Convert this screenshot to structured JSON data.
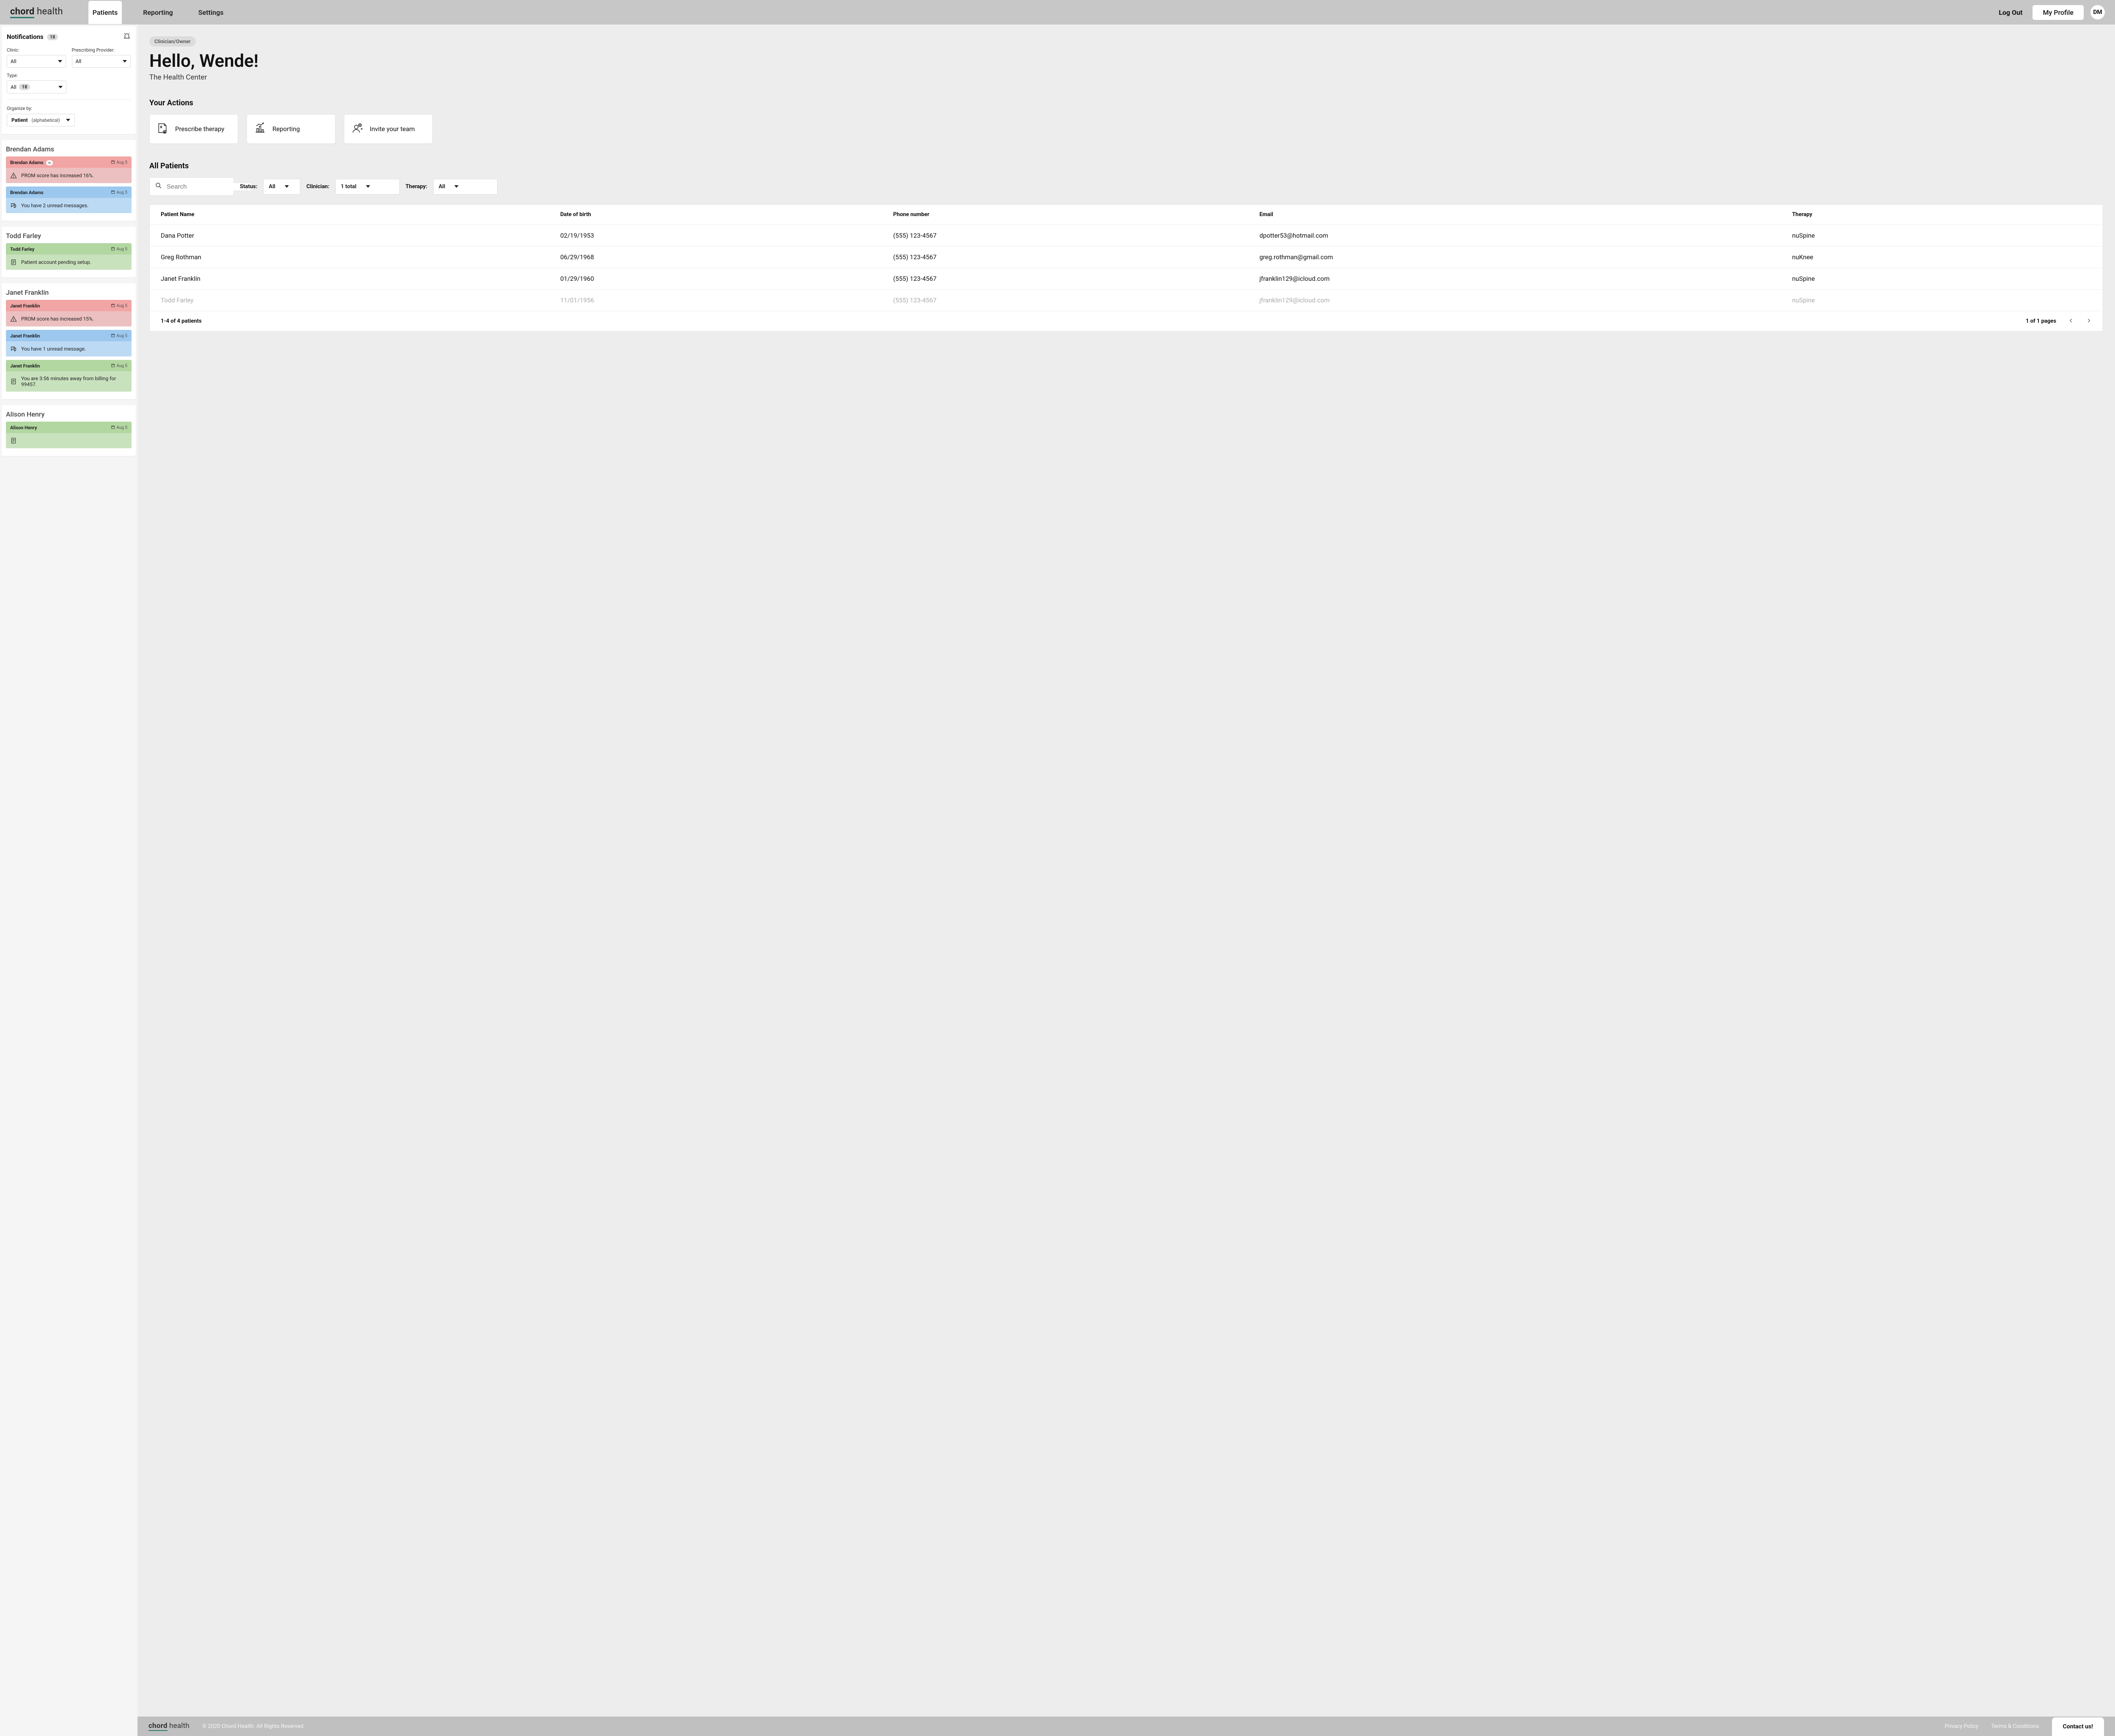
{
  "brand": {
    "first": "chord",
    "second": "health"
  },
  "nav": {
    "items": [
      "Patients",
      "Reporting",
      "Settings"
    ],
    "active": 0
  },
  "header": {
    "logout": "Log Out",
    "profile_btn": "My Profile",
    "initials": "DM"
  },
  "notifications": {
    "title": "Notifications",
    "count": "18",
    "filters": {
      "clinic_label": "Clinic:",
      "clinic_value": "All",
      "provider_label": "Prescribing Provider:",
      "provider_value": "All",
      "type_label": "Type:",
      "type_value": "All",
      "type_count": "18"
    },
    "organize_label": "Organize by:",
    "organize_main": "Patient",
    "organize_sub": "(alphabetical)"
  },
  "patient_groups": [
    {
      "name": "Brendan Adams",
      "cards": [
        {
          "color": "red",
          "name": "Brendan Adams",
          "eye": true,
          "date": "Aug 5",
          "icon": "warning",
          "message": "PROM score has increased 16%."
        },
        {
          "color": "blue",
          "name": "Brendan Adams",
          "eye": false,
          "date": "Aug 5",
          "icon": "chat",
          "message": "You have 2 unread messages."
        }
      ]
    },
    {
      "name": "Todd Farley",
      "cards": [
        {
          "color": "green",
          "name": "Todd Farley",
          "eye": false,
          "date": "Aug 5",
          "icon": "doc",
          "message": "Patient account pending  setup."
        }
      ]
    },
    {
      "name": "Janet Franklin",
      "cards": [
        {
          "color": "red",
          "name": "Janet Franklin",
          "eye": false,
          "date": "Aug 5",
          "icon": "warning",
          "message": "PROM score has increased 15%."
        },
        {
          "color": "blue",
          "name": "Janet Franklin",
          "eye": false,
          "date": "Aug 5",
          "icon": "chat",
          "message": "You have 1 unread message."
        },
        {
          "color": "green",
          "name": "Janet Franklin",
          "eye": false,
          "date": "Aug 5",
          "icon": "doc",
          "message": "You are 3:56 minutes away from billing for 99457."
        }
      ]
    },
    {
      "name": "Alison Henry",
      "cards": [
        {
          "color": "green",
          "name": "Alison Henry",
          "eye": false,
          "date": "Aug 5",
          "icon": "doc",
          "message": ""
        }
      ]
    }
  ],
  "main": {
    "role": "Clinician/Owner",
    "hello": "Hello, Wende!",
    "clinic": "The Health Center",
    "actions_heading": "Your Actions",
    "actions": [
      {
        "label": "Prescribe therapy",
        "icon": "prescribe"
      },
      {
        "label": "Reporting",
        "icon": "chart"
      },
      {
        "label": "Invite your team",
        "icon": "invite"
      }
    ],
    "patients_heading": "All Patients",
    "search_placeholder": "Search",
    "filters": {
      "status_label": "Status:",
      "status_value": "All",
      "clinician_label": "Clinician:",
      "clinician_value": "1 total",
      "therapy_label": "Therapy:",
      "therapy_value": "All"
    },
    "table": {
      "headers": [
        "Patient Name",
        "Date of birth",
        "Phone number",
        "Email",
        "Therapy"
      ],
      "rows": [
        {
          "name": "Dana Potter",
          "dob": "02/19/1953",
          "phone": "(555) 123-4567",
          "email": "dpotter53@hotmail.com",
          "therapy": "nuSpine",
          "muted": false
        },
        {
          "name": "Greg Rothman",
          "dob": "06/29/1968",
          "phone": "(555) 123-4567",
          "email": "greg.rothman@gmail.com",
          "therapy": "nuKnee",
          "muted": false
        },
        {
          "name": "Janet Franklin",
          "dob": "01/29/1960",
          "phone": "(555) 123-4567",
          "email": "jfranklin129@icloud.com",
          "therapy": "nuSpine",
          "muted": false
        },
        {
          "name": "Todd Farley",
          "dob": "11/01/1956",
          "phone": "(555) 123-4567",
          "email": "jfranklin129@icloud.com",
          "therapy": "nuSpine",
          "muted": true
        }
      ],
      "footer_count": "1-4 of 4 patients",
      "footer_pages": "1 of 1 pages"
    }
  },
  "footer": {
    "copyright": "© 2020 Chord Health. All Rights Reserved.",
    "privacy": "Privacy Policy",
    "terms": "Terms & Conditions",
    "contact": "Contact us!"
  }
}
